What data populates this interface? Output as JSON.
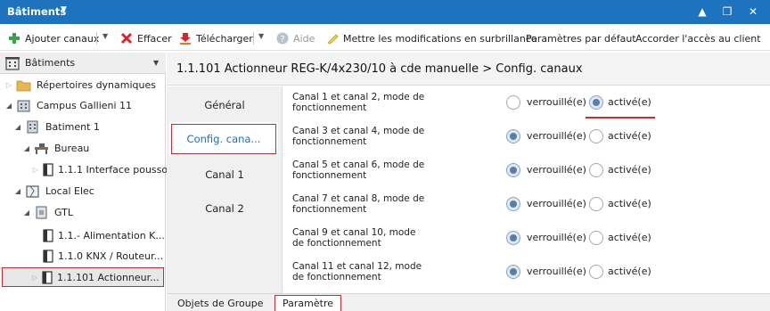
{
  "window": {
    "title": "Bâtiments",
    "controls": [
      "▲",
      "❐",
      "✕"
    ]
  },
  "toolbar": {
    "add_channels": "Ajouter canaux",
    "delete": "Effacer",
    "download": "Télécharger",
    "help": "Aide",
    "highlight": "Mettre les modifications en surbrillance",
    "default_params": "Paramètres par défaut",
    "grant_access": "Accorder l'accès au client"
  },
  "tree": {
    "header": "Bâtiments",
    "items": [
      {
        "label": "Répertoires dynamiques",
        "icon": "folder-icon"
      },
      {
        "label": "Campus Gallieni 11",
        "icon": "building-icon"
      },
      {
        "label": "Batiment 1",
        "icon": "building-icon"
      },
      {
        "label": "Bureau",
        "icon": "room-icon"
      },
      {
        "label": "1.1.1 Interface pousso...",
        "icon": "device-icon"
      },
      {
        "label": "Local Elec",
        "icon": "room-icon"
      },
      {
        "label": "GTL",
        "icon": "cabinet-icon"
      },
      {
        "label": "1.1.- Alimentation K...",
        "icon": "device-icon"
      },
      {
        "label": "1.1.0 KNX / Routeur...",
        "icon": "device-icon"
      },
      {
        "label": "1.1.101 Actionneur...",
        "icon": "device-icon"
      }
    ]
  },
  "main": {
    "title": "1.1.101 Actionneur REG-K/4x230/10 à cde manuelle > Config. canaux",
    "nav": [
      "Général",
      "Config. cana...",
      "Canal 1",
      "Canal 2"
    ],
    "params": [
      {
        "label": "Canal 1 et canal 2, mode de fonctionnement",
        "value": "activé(e)"
      },
      {
        "label": "Canal 3 et canal 4, mode de fonctionnement",
        "value": "verrouillé(e)"
      },
      {
        "label": "Canal 5 et canal 6, mode de fonctionnement",
        "value": "verrouillé(e)"
      },
      {
        "label": "Canal 7 et canal 8, mode de fonctionnement",
        "value": "verrouillé(e)"
      },
      {
        "label": "Canal 9 et canal 10, mode de fonctionnement",
        "value": "verrouillé(e)"
      },
      {
        "label": "Canal 11 et canal 12, mode de fonctionnement",
        "value": "verrouillé(e)"
      }
    ],
    "options": {
      "locked": "verrouillé(e)",
      "active": "activé(e)"
    },
    "bottom_tabs": [
      "Objets de Groupe",
      "Paramètre"
    ]
  }
}
